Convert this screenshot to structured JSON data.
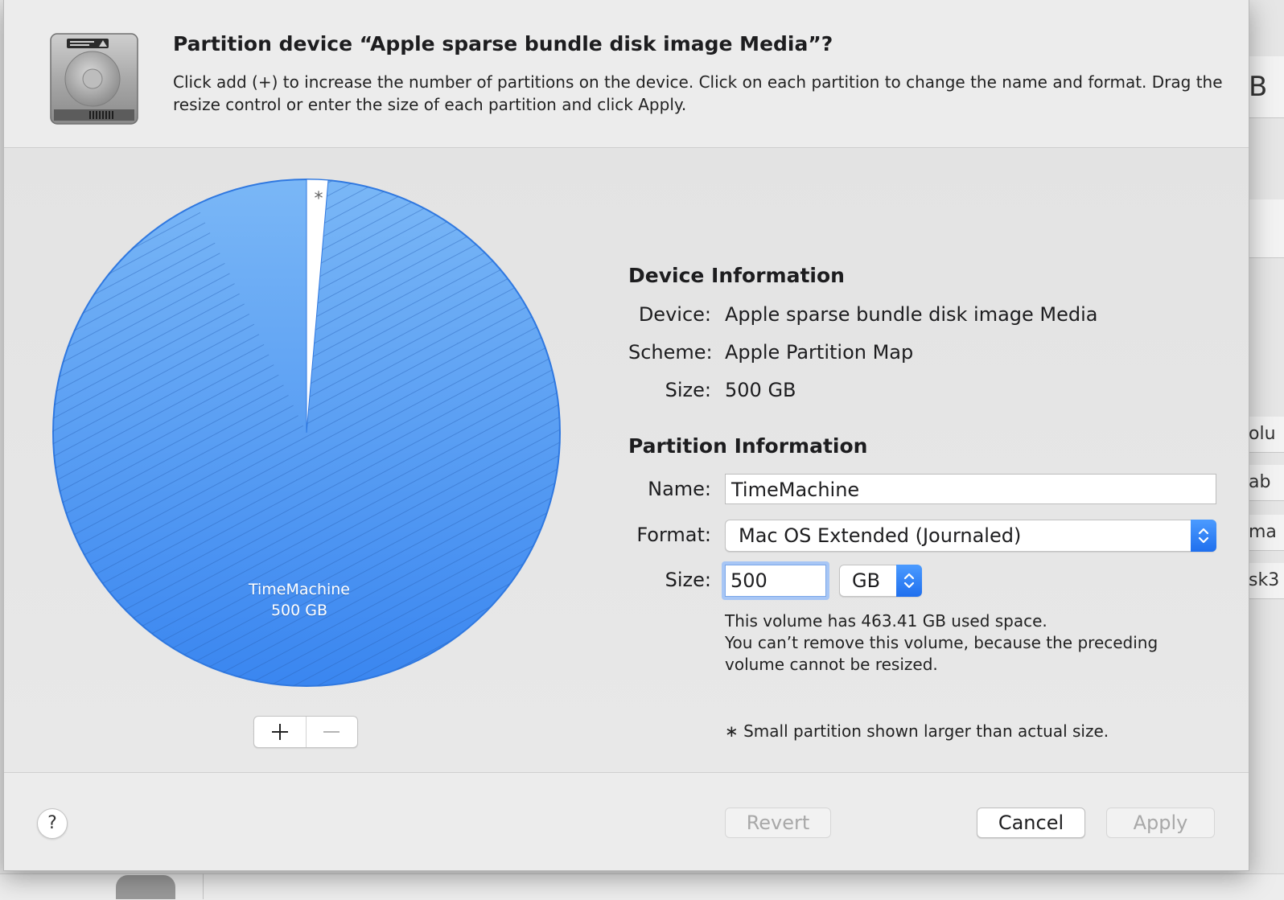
{
  "dialog": {
    "title": "Partition device “Apple sparse bundle disk image Media”?",
    "subtitle": "Click add (+) to increase the number of partitions on the device. Click on each partition to change the name and format. Drag the resize control or enter the size of each partition and click Apply.",
    "icon": "hard-drive-icon"
  },
  "pie": {
    "small_partition_marker": "*",
    "partition_name": "TimeMachine",
    "partition_size": "500 GB",
    "colors": {
      "partition": "#4c97f2",
      "free": "#ffffff",
      "stroke": "#2f78e0"
    }
  },
  "controls": {
    "add_label": "+",
    "remove_label": "—"
  },
  "device_info": {
    "heading": "Device Information",
    "device_label": "Device:",
    "device_value": "Apple sparse bundle disk image Media",
    "scheme_label": "Scheme:",
    "scheme_value": "Apple Partition Map",
    "size_label": "Size:",
    "size_value": "500 GB"
  },
  "partition_info": {
    "heading": "Partition Information",
    "name_label": "Name:",
    "name_value": "TimeMachine",
    "format_label": "Format:",
    "format_value": "Mac OS Extended (Journaled)",
    "size_label": "Size:",
    "size_value": "500",
    "unit_value": "GB",
    "note_line1": "This volume has 463.41 GB used space.",
    "note_line2": "You can’t remove this volume, because the preceding",
    "note_line3": "volume cannot be resized.",
    "footnote": "∗ Small partition shown larger than actual size."
  },
  "footer": {
    "help_label": "?",
    "revert_label": "Revert",
    "cancel_label": "Cancel",
    "apply_label": "Apply"
  },
  "background_window": {
    "fragments": [
      "B",
      "olu",
      "ab",
      "ma",
      "sk3"
    ]
  },
  "colors": {
    "accent": "#2f7bf0"
  }
}
